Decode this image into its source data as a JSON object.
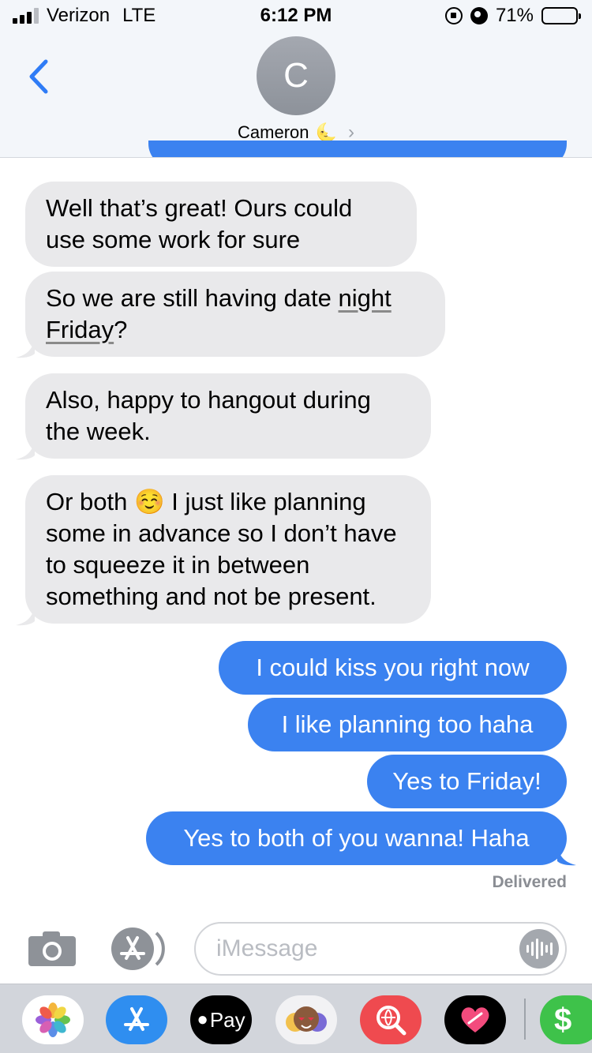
{
  "status_bar": {
    "carrier": "Verizon",
    "network": "LTE",
    "time": "6:12 PM",
    "battery": "71%",
    "battery_level": 0.71
  },
  "header": {
    "avatar_initial": "C",
    "contact_name": "Cameron",
    "contact_emoji": "🌜",
    "chevron": "›"
  },
  "messages": [
    {
      "direction": "incoming",
      "text": "Well that’s great!  Ours could use some work for sure"
    },
    {
      "direction": "incoming",
      "text_a": "So we are still having date ",
      "text_b": "night",
      "text_c": "Friday",
      "text_d": "?"
    },
    {
      "direction": "incoming",
      "text": "Also, happy to hangout during the week."
    },
    {
      "direction": "incoming",
      "text_a": "Or both ",
      "emoji": "☺️",
      "text_b": " I just like planning some in advance so I don’t have to squeeze it in between something and not be present."
    },
    {
      "direction": "outgoing",
      "text": "I could kiss you right now"
    },
    {
      "direction": "outgoing",
      "text": "I like planning too haha"
    },
    {
      "direction": "outgoing",
      "text": "Yes to Friday!"
    },
    {
      "direction": "outgoing",
      "text": "Yes to both of you wanna! Haha"
    }
  ],
  "delivery_status": "Delivered",
  "input": {
    "placeholder": "iMessage",
    "value": ""
  },
  "drawer": {
    "apple_pay_label": "Pay",
    "cash_label": "$"
  },
  "colors": {
    "outgoing_bubble": "#3b82f0",
    "incoming_bubble": "#e9e9eb",
    "accent": "#2f7cf6"
  },
  "icons": [
    "back-chevron-icon",
    "camera-icon",
    "app-store-icon",
    "audio-waveform-icon",
    "photos-icon",
    "apple-pay-icon",
    "memoji-icon",
    "search-images-icon",
    "digital-touch-icon",
    "apple-cash-icon"
  ]
}
